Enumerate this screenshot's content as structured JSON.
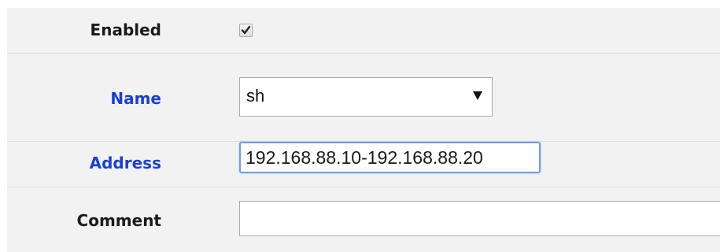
{
  "form": {
    "enabled": {
      "label": "Enabled",
      "checked": true
    },
    "name": {
      "label": "Name",
      "value": "sh"
    },
    "address": {
      "label": "Address",
      "value": "192.168.88.10-192.168.88.20"
    },
    "comment": {
      "label": "Comment",
      "value": ""
    }
  },
  "colors": {
    "link_label": "#1a3fd6",
    "panel_bg": "#f2f2f2",
    "focus_border": "#6f9fe0"
  },
  "icons": {
    "check": "check-icon",
    "dropdown": "chevron-down-icon"
  }
}
